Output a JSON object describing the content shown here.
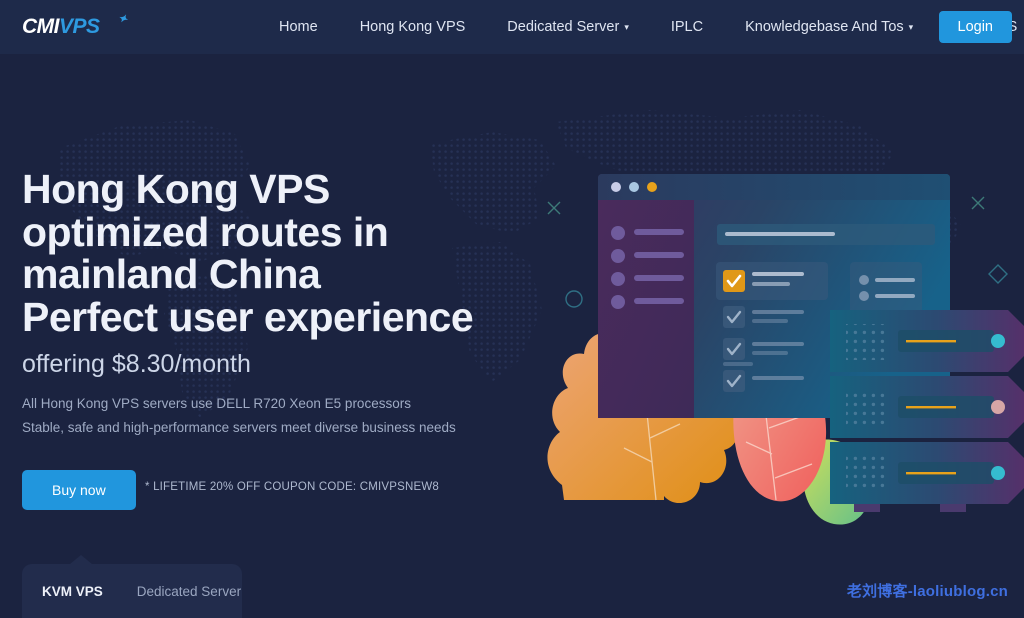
{
  "site": {
    "logo_cmi": "CMI",
    "logo_vps": "VPS",
    "background_color": "#1b2340",
    "navbar_color": "#1e2a4a",
    "accent_color": "#2196dd"
  },
  "nav": {
    "items": [
      {
        "label": "Home",
        "has_dropdown": false
      },
      {
        "label": "Hong Kong VPS",
        "has_dropdown": false
      },
      {
        "label": "Dedicated Server",
        "has_dropdown": true
      },
      {
        "label": "IPLC",
        "has_dropdown": false
      },
      {
        "label": "Knowledgebase And Tos",
        "has_dropdown": true
      },
      {
        "label": "About US",
        "has_dropdown": false
      }
    ],
    "login_label": "Login",
    "caret_glyph": "▾"
  },
  "hero": {
    "title_line1": "Hong Kong VPS",
    "title_line2": "optimized routes in",
    "title_line3": "mainland China",
    "title_line4": "Perfect user experience",
    "subtitle": "offering $8.30/month",
    "desc_line1": "All Hong Kong VPS servers use DELL R720 Xeon E5 processors",
    "desc_line2": "Stable, safe and high-performance servers meet diverse business needs",
    "buy_label": "Buy now",
    "coupon_note": "* LIFETIME 20% OFF COUPON CODE: CMIVPSNEW8"
  },
  "tabs": {
    "items": [
      {
        "label": "KVM VPS",
        "active": true
      },
      {
        "label": "Dedicated Server",
        "active": false
      }
    ]
  },
  "watermark": {
    "text": "老刘博客-laoliublog.cn",
    "color": "#3f6fe0"
  },
  "illustration": {
    "window_dots": [
      "#c8cde8",
      "#a9c7e2",
      "#e8a21b"
    ],
    "highlight_color": "#e09818",
    "server_led_colors": [
      "#35bccf",
      "#d6a6a6",
      "#35bccf"
    ],
    "leaf_left_color": "#e8963c",
    "leaf_right_color": "#f2736f"
  }
}
